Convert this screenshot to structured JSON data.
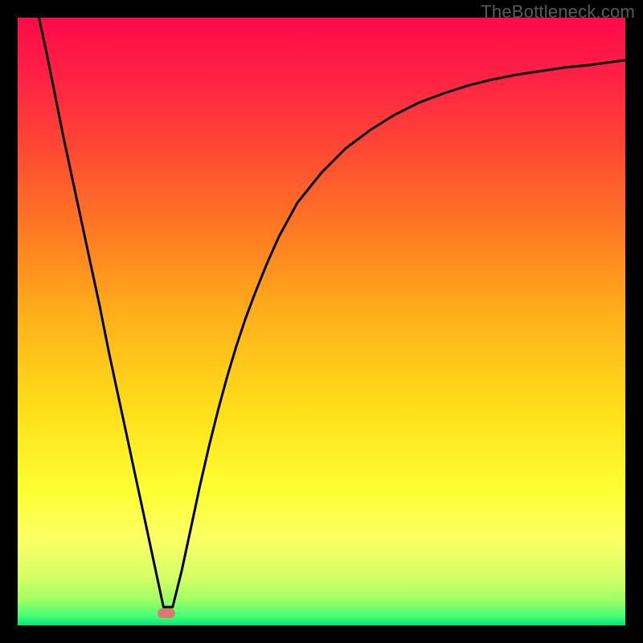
{
  "watermark": "TheBottleneck.com",
  "colors": {
    "frame": "#000000",
    "curve": "#000000",
    "marker": "#d87a6e",
    "gradient_stops": [
      {
        "offset": 0.0,
        "color": "#ff0a4a"
      },
      {
        "offset": 0.1,
        "color": "#ff2244"
      },
      {
        "offset": 0.22,
        "color": "#ff4a33"
      },
      {
        "offset": 0.35,
        "color": "#ff7a22"
      },
      {
        "offset": 0.5,
        "color": "#ffb31a"
      },
      {
        "offset": 0.65,
        "color": "#ffe01a"
      },
      {
        "offset": 0.78,
        "color": "#ffff33"
      },
      {
        "offset": 0.86,
        "color": "#fbff66"
      },
      {
        "offset": 0.92,
        "color": "#d6ff66"
      },
      {
        "offset": 0.96,
        "color": "#9cff66"
      },
      {
        "offset": 0.985,
        "color": "#44ff77"
      },
      {
        "offset": 1.0,
        "color": "#00e878"
      }
    ]
  },
  "chart_data": {
    "type": "line",
    "title": "",
    "xlabel": "",
    "ylabel": "",
    "xlim": [
      0,
      1
    ],
    "ylim": [
      0,
      1
    ],
    "annotations": [
      {
        "name": "marker",
        "x": 0.245,
        "y": 0.02,
        "shape": "pill",
        "color": "#d87a6e"
      }
    ],
    "series": [
      {
        "name": "curve",
        "x": [
          0.035,
          0.048,
          0.06,
          0.075,
          0.09,
          0.105,
          0.12,
          0.135,
          0.15,
          0.165,
          0.18,
          0.195,
          0.21,
          0.225,
          0.24,
          0.255,
          0.27,
          0.285,
          0.3,
          0.315,
          0.33,
          0.345,
          0.36,
          0.375,
          0.39,
          0.41,
          0.43,
          0.46,
          0.5,
          0.54,
          0.58,
          0.62,
          0.66,
          0.7,
          0.74,
          0.78,
          0.82,
          0.86,
          0.9,
          0.94,
          0.97,
          1.0
        ],
        "y": [
          1.0,
          0.94,
          0.88,
          0.805,
          0.735,
          0.665,
          0.595,
          0.525,
          0.45,
          0.38,
          0.31,
          0.24,
          0.17,
          0.1,
          0.03,
          0.03,
          0.09,
          0.16,
          0.23,
          0.295,
          0.355,
          0.41,
          0.46,
          0.505,
          0.545,
          0.595,
          0.64,
          0.695,
          0.745,
          0.785,
          0.815,
          0.84,
          0.86,
          0.875,
          0.888,
          0.898,
          0.906,
          0.912,
          0.918,
          0.922,
          0.926,
          0.93
        ]
      }
    ]
  }
}
